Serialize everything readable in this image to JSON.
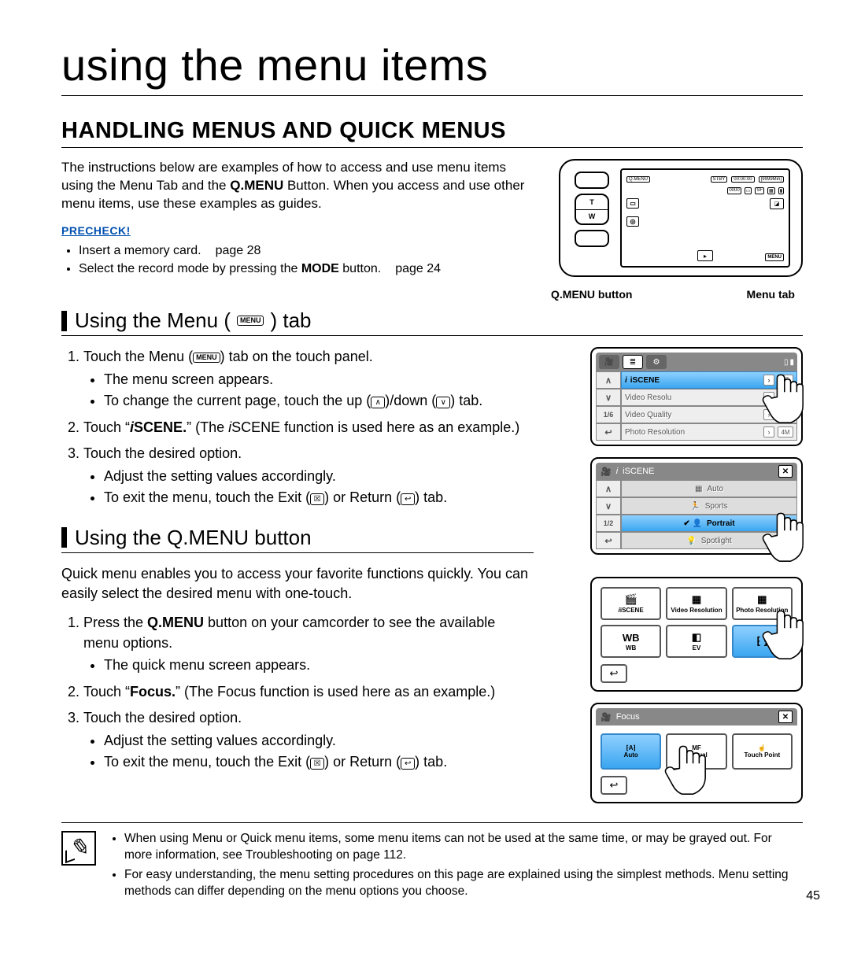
{
  "page_title": "using the menu items",
  "section_title": "HANDLING MENUS AND QUICK MENUS",
  "intro_pre": "The instructions below are examples of how to access and use menu items using the Menu Tab and the ",
  "intro_bold": "Q.MENU",
  "intro_post": " Button. When you access and use other menu items, use these examples as guides.",
  "precheck_label": "PRECHECK!",
  "precheck_items": {
    "a": "Insert a memory card.",
    "a_page": "page 28",
    "b_pre": "Select the record mode by pressing the ",
    "b_bold": "MODE",
    "b_post": " button.",
    "b_page": "page 24"
  },
  "cam_labels": {
    "qmenu": "Q.MENU button",
    "menutab": "Menu tab"
  },
  "menu_chip": "MENU",
  "sub1_pre": "Using the Menu (",
  "sub1_post": ") tab",
  "steps1": {
    "s1_pre": "Touch the Menu (",
    "s1_post": ") tab on the touch panel.",
    "s1a": "The menu screen appears.",
    "s1b_pre": "To change the current page, touch the up (",
    "s1b_mid": ")/down (",
    "s1b_post": ") tab.",
    "s2_pre": "Touch “",
    "s2_bold": "iSCENE.",
    "s2_mid": "” (The ",
    "s2_italic": "i",
    "s2_post": "SCENE function is used here as an example.)",
    "s3": "Touch the desired option.",
    "s3a": "Adjust the setting values accordingly.",
    "s3b_pre": "To exit the menu, touch the Exit (",
    "s3b_mid": ") or Return (",
    "s3b_post": ") tab."
  },
  "sub2": "Using the Q.MENU button",
  "qintro": "Quick menu enables you to access your favorite functions quickly. You can easily select the desired menu with one-touch.",
  "steps2": {
    "s1_pre": "Press the ",
    "s1_bold": "Q.MENU",
    "s1_post": " button on your camcorder to see the available menu options.",
    "s1a": "The quick menu screen appears.",
    "s2_pre": "Touch “",
    "s2_bold": "Focus.",
    "s2_post": "” (The Focus function is used here as an example.)",
    "s3": "Touch the desired option.",
    "s3a": "Adjust the setting values accordingly.",
    "s3b_pre": "To exit the menu, touch the Exit (",
    "s3b_mid": ") or Return (",
    "s3b_post": ") tab."
  },
  "ui_menu": {
    "pager": "1/6",
    "rows": [
      "iSCENE",
      "Video Resolu",
      "Video Quality",
      "Photo Resolution"
    ],
    "right": [
      "🎬",
      "📼",
      "🏞",
      "4M"
    ]
  },
  "ui_iscene": {
    "title": "iSCENE",
    "pager": "1/2",
    "rows": [
      "Auto",
      "Sports",
      "Portrait",
      "Spotlight"
    ]
  },
  "ui_qmenu": {
    "cells": [
      "iSCENE",
      "Video Resolution",
      "Photo Resolution",
      "WB",
      "EV",
      ""
    ]
  },
  "ui_focus": {
    "title": "Focus",
    "cells": [
      "Auto",
      "Manual",
      "Touch Point"
    ]
  },
  "notes": {
    "a": "When using Menu or Quick menu items, some menu items can not be used at the same time, or may be grayed out. For more information, see Troubleshooting on page 112.",
    "b": "For easy understanding, the menu setting procedures on this page are explained using the simplest methods. Menu setting methods can differ depending on the menu options you choose."
  },
  "page_number": "45",
  "icons": {
    "up": "∧",
    "down": "∨",
    "exit": "☒",
    "return": "↩"
  }
}
